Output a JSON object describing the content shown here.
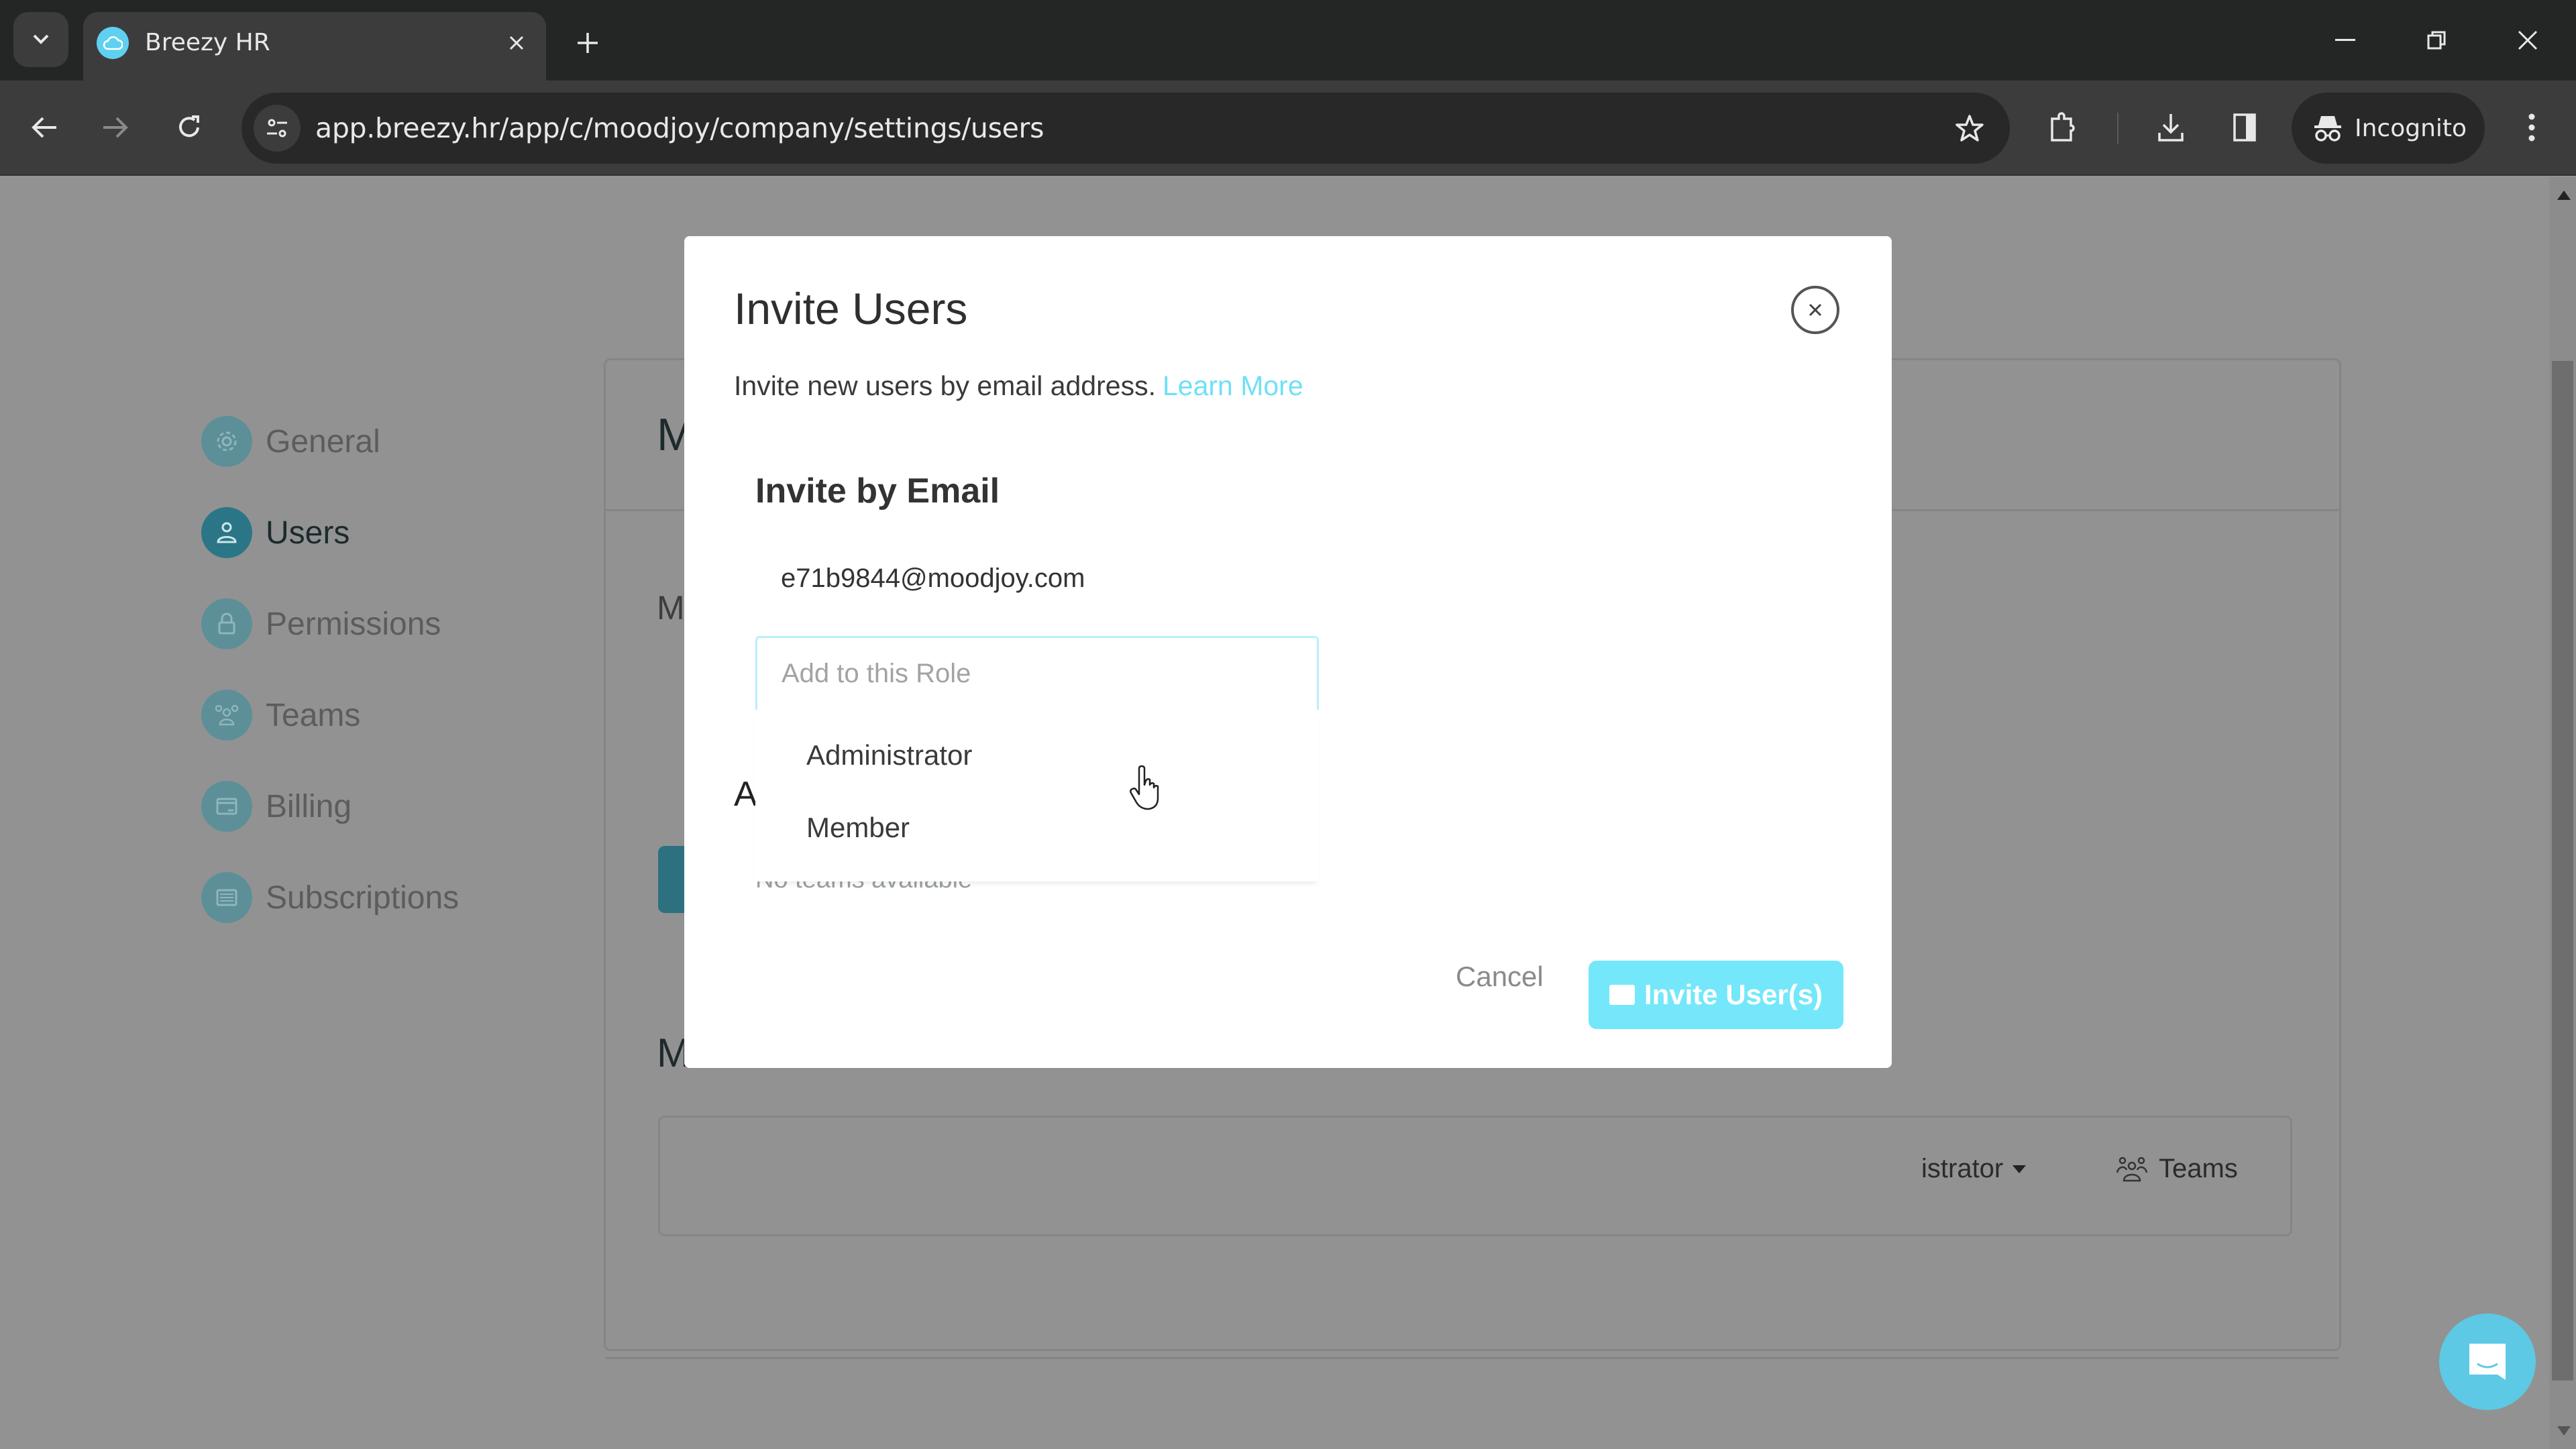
{
  "browser": {
    "tab_title": "Breezy HR",
    "url": "app.breezy.hr/app/c/moodjoy/company/settings/users",
    "profile_label": "Incognito",
    "icons": [
      "tab-search-icon",
      "favicon-cloud-icon",
      "close-tab-icon",
      "new-tab-icon",
      "minimize-icon",
      "restore-icon",
      "close-window-icon",
      "back-icon",
      "forward-icon",
      "reload-icon",
      "site-info-icon",
      "bookmark-star-icon",
      "extensions-icon",
      "download-icon",
      "side-panel-icon",
      "incognito-icon",
      "more-menu-icon"
    ]
  },
  "sidebar": {
    "items": [
      {
        "label": "General",
        "icon": "gear-icon",
        "active": false
      },
      {
        "label": "Users",
        "icon": "user-icon",
        "active": true
      },
      {
        "label": "Permissions",
        "icon": "lock-icon",
        "active": false
      },
      {
        "label": "Teams",
        "icon": "team-icon",
        "active": false
      },
      {
        "label": "Billing",
        "icon": "billing-icon",
        "active": false
      },
      {
        "label": "Subscriptions",
        "icon": "subscriptions-icon",
        "active": false
      }
    ]
  },
  "background_panel": {
    "heading_initial": "M",
    "subheading_initial": "M",
    "section_initial": "M",
    "member_row": {
      "role_partial": "istrator",
      "teams_label": "Teams"
    }
  },
  "modal": {
    "title": "Invite Users",
    "subtitle": "Invite new users by email address.",
    "learn_more": "Learn More",
    "section_title": "Invite by Email",
    "email": "e71b9844@moodjoy.com",
    "role_input": {
      "value": "",
      "placeholder": "Add to this Role"
    },
    "role_options": [
      "Administrator",
      "Member"
    ],
    "obscured_label_initial": "A",
    "teams_empty": "No teams available",
    "cancel_label": "Cancel",
    "invite_label": "Invite User(s)"
  },
  "colors": {
    "accent": "#74e7fa",
    "link": "#6fe0f5",
    "sidebar_active": "#2a7687",
    "chat_bubble": "#5dc9e4"
  }
}
